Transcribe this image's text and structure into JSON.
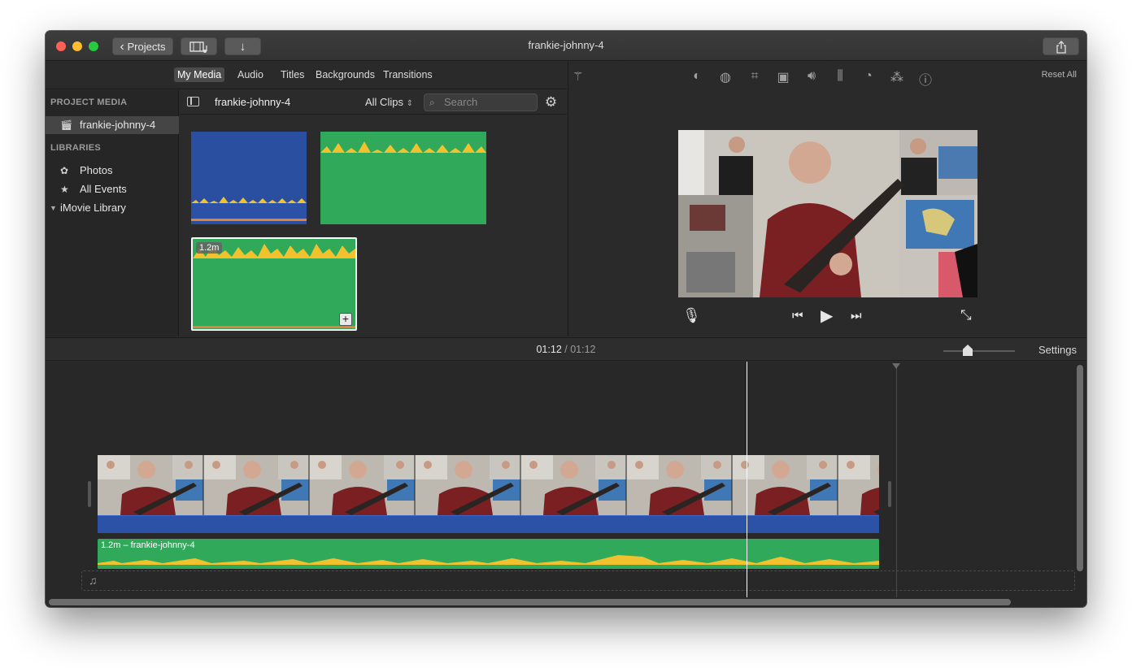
{
  "window": {
    "title": "frankie-johnny-4",
    "projects_label": "Projects"
  },
  "toolbar": {
    "projects_chevron": "‹",
    "media_icon": "film-music-icon",
    "import_icon": "↓",
    "share_icon": "⇪"
  },
  "browser_tabs": [
    "My Media",
    "Audio",
    "Titles",
    "Backgrounds",
    "Transitions"
  ],
  "sidebar": {
    "project_media_heading": "PROJECT MEDIA",
    "project_item": "frankie-johnny-4",
    "libraries_heading": "LIBRARIES",
    "library_items": [
      "Photos",
      "All Events"
    ],
    "library_name": "iMovie Library"
  },
  "media_browser": {
    "title": "frankie-johnny-4",
    "filter": "All Clips",
    "search_placeholder": "Search",
    "clip_badge": "1.2m",
    "plus": "+"
  },
  "viewer": {
    "reset_all": "Reset All",
    "tool_icons": [
      "color-balance-icon",
      "color-correction-icon",
      "crop-icon",
      "stabilization-icon",
      "volume-icon",
      "equalizer-icon",
      "speed-icon",
      "filter-icon",
      "info-icon"
    ]
  },
  "timeline": {
    "current_time": "01:12",
    "separator": "/",
    "total_time": "01:12",
    "settings_label": "Settings",
    "audio_clip_label": "1.2m – frankie-johnny-4",
    "music_glyph": "♫"
  },
  "colors": {
    "audio_green": "#31a95a",
    "audio_blue": "#2b52a6",
    "waveform_yellow": "#f2c12e",
    "audio_orange": "#e2833a"
  }
}
